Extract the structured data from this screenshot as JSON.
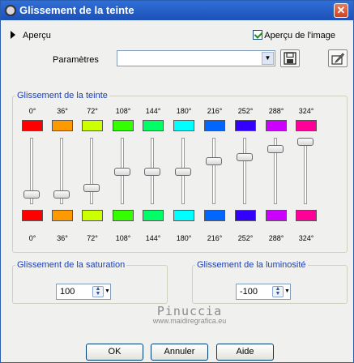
{
  "window": {
    "title": "Glissement de la teinte",
    "close_glyph": "✕"
  },
  "preview": {
    "label": "Aperçu",
    "image_preview_label": "Aperçu de l'image",
    "image_preview_checked": true
  },
  "params": {
    "label": "Paramètres",
    "selected": ""
  },
  "hue_group": {
    "title": "Glissement de la teinte",
    "channels": [
      {
        "label": "0°",
        "color": "#ff0000",
        "level": 0.9
      },
      {
        "label": "36°",
        "color": "#ff9900",
        "level": 0.9
      },
      {
        "label": "72°",
        "color": "#ccff00",
        "level": 0.79
      },
      {
        "label": "108°",
        "color": "#33ff00",
        "level": 0.51
      },
      {
        "label": "144°",
        "color": "#00ff66",
        "level": 0.51
      },
      {
        "label": "180°",
        "color": "#00ffff",
        "level": 0.51
      },
      {
        "label": "216°",
        "color": "#0066ff",
        "level": 0.34
      },
      {
        "label": "252°",
        "color": "#3300ff",
        "level": 0.26
      },
      {
        "label": "288°",
        "color": "#cc00ff",
        "level": 0.13
      },
      {
        "label": "324°",
        "color": "#ff0099",
        "level": 0.0
      }
    ]
  },
  "saturation": {
    "title": "Glissement de la saturation",
    "value": "100"
  },
  "luminosity": {
    "title": "Glissement de la luminosité",
    "value": "-100"
  },
  "watermark": {
    "name": "Pinuccia",
    "url": "www.maidiregrafica.eu"
  },
  "buttons": {
    "ok": "OK",
    "cancel": "Annuler",
    "help": "Aide"
  }
}
